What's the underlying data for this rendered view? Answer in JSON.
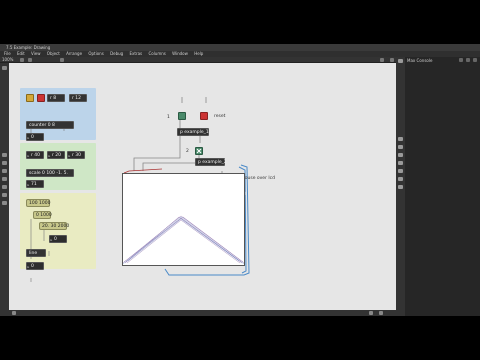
{
  "window": {
    "title": "7.5 Example: Drawing"
  },
  "menu": [
    "File",
    "Edit",
    "View",
    "Object",
    "Arrange",
    "Options",
    "Debug",
    "Extras",
    "Columns",
    "Window",
    "Help"
  ],
  "toolbar": {
    "zoom": "100%"
  },
  "right_panel": {
    "header": "Max Console"
  },
  "patch": {
    "toggle_labels": {
      "n1": "1",
      "n2": "2",
      "n3": "3"
    },
    "reset_label": "reset",
    "pexample1": "p example_1",
    "pexample2": "p example_2",
    "pexample3": "p example_3",
    "drag_label": "Drag mouse over lcd",
    "clear_label": "clear",
    "counter_obj": "counter 0 8",
    "counter_num": "0",
    "sub1": "r 8",
    "sub2": "r 12",
    "r40": "r 40",
    "r20": "r 20",
    "r30": "r 30",
    "scale_obj": "scale 0 100 -1. 5.",
    "scale_num": "71",
    "msg_100_1000": "100 1000",
    "msg_0_1000": "0 1000",
    "msg_20_30": "20. 30 2000",
    "line_num": "0",
    "line_obj": "line",
    "line_out": "0"
  }
}
